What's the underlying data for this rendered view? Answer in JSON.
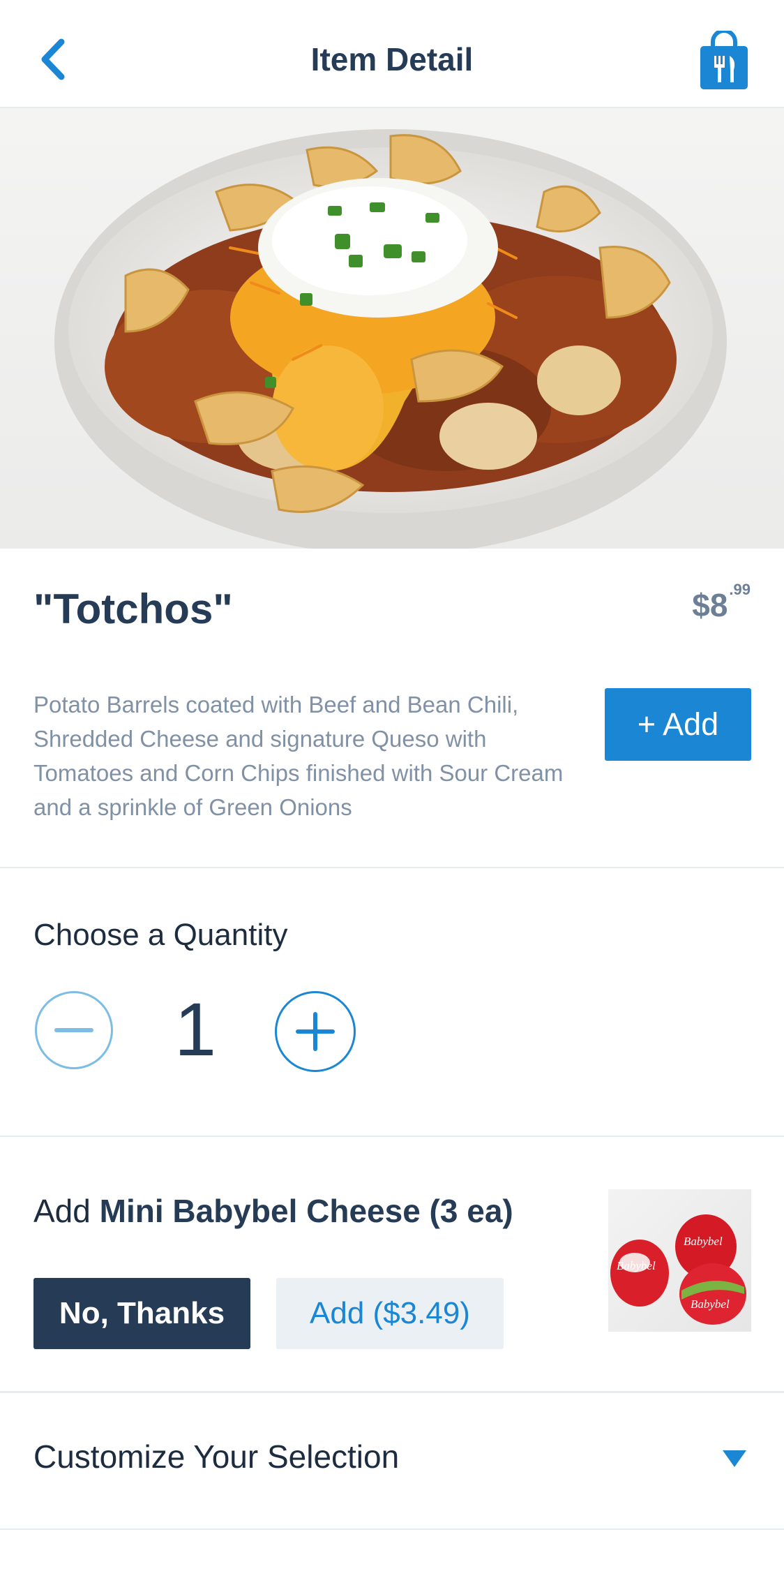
{
  "header": {
    "title": "Item Detail",
    "back_icon": "chevron-left-icon",
    "bag_icon": "shopping-bag-utensils-icon",
    "accent_color": "#1b86d4"
  },
  "item": {
    "name": "\"Totchos\"",
    "price_dollars": "$8",
    "price_cents": ".99",
    "description": "Potato Barrels coated with Beef and Bean Chili, Shredded Cheese and signature Queso with Tomatoes and Corn Chips finished with Sour Cream and a sprinkle of Green Onions",
    "add_label": "+ Add"
  },
  "quantity": {
    "label": "Choose a Quantity",
    "value": "1",
    "minus_icon": "minus-circle-icon",
    "plus_icon": "plus-circle-icon"
  },
  "addon": {
    "prefix": "Add ",
    "name": "Mini Babybel Cheese (3 ea)",
    "decline_label": "No, Thanks",
    "accept_label": "Add ($3.49)",
    "image_text": "Babybel"
  },
  "customize": {
    "label": "Customize Your Selection",
    "caret_icon": "caret-down-icon"
  },
  "colors": {
    "navy": "#253b56",
    "blue": "#1b86d4",
    "muted": "#8091a5"
  }
}
